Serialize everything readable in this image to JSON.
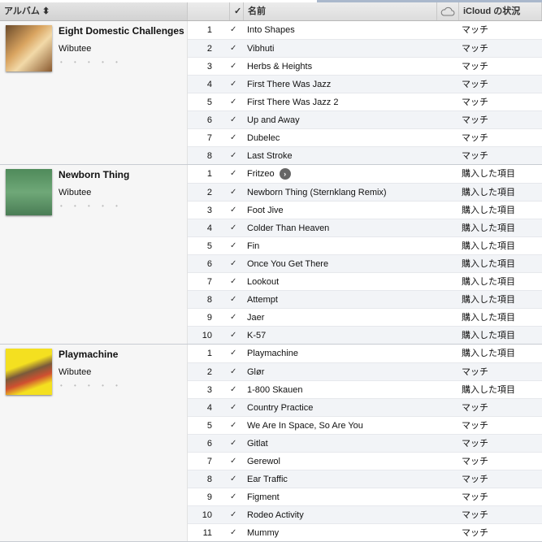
{
  "header": {
    "album": "アルバム ⬍",
    "check": "✓",
    "name": "名前",
    "status": "iCloud の状況"
  },
  "albums": [
    {
      "title": "Eight Domestic Challenges",
      "artist": "Wibutee",
      "rating": "• • • • •",
      "art": "linear-gradient(135deg,#6b4a2a,#d9a460 40%,#f2d9a8 60%,#8a5a30)",
      "tracks": [
        [
          "1",
          "Into Shapes",
          "マッチ"
        ],
        [
          "2",
          "Vibhuti",
          "マッチ"
        ],
        [
          "3",
          "Herbs & Heights",
          "マッチ"
        ],
        [
          "4",
          "First There Was Jazz",
          "マッチ"
        ],
        [
          "5",
          "First There Was Jazz 2",
          "マッチ"
        ],
        [
          "6",
          "Up and Away",
          "マッチ"
        ],
        [
          "7",
          "Dubelec",
          "マッチ"
        ],
        [
          "8",
          "Last Stroke",
          "マッチ"
        ]
      ]
    },
    {
      "title": "Newborn Thing",
      "artist": "Wibutee",
      "rating": "• • • • •",
      "art": "linear-gradient(#4f8a5a,#6fa878 50%,#4a7d55)",
      "tracks": [
        [
          "1",
          "Fritzeo",
          "購入した項目"
        ],
        [
          "2",
          "Newborn Thing (Sternklang Remix)",
          "購入した項目"
        ],
        [
          "3",
          "Foot Jive",
          "購入した項目"
        ],
        [
          "4",
          "Colder Than Heaven",
          "購入した項目"
        ],
        [
          "5",
          "Fin",
          "購入した項目"
        ],
        [
          "6",
          "Once You Get There",
          "購入した項目"
        ],
        [
          "7",
          "Lookout",
          "購入した項目"
        ],
        [
          "8",
          "Attempt",
          "購入した項目"
        ],
        [
          "9",
          "Jaer",
          "購入した項目"
        ],
        [
          "10",
          "K-57",
          "購入した項目"
        ]
      ]
    },
    {
      "title": "Playmachine",
      "artist": "Wibutee",
      "rating": "• • • • •",
      "art": "linear-gradient(160deg,#f4e020 0 35%,#7a5a3a 50%,#d05030 65%,#f4e020 80%)",
      "tracks": [
        [
          "1",
          "Playmachine",
          "購入した項目"
        ],
        [
          "2",
          "Glør",
          "マッチ"
        ],
        [
          "3",
          "1-800 Skauen",
          "購入した項目"
        ],
        [
          "4",
          "Country Practice",
          "マッチ"
        ],
        [
          "5",
          "We Are In Space, So Are You",
          "マッチ"
        ],
        [
          "6",
          "Gitlat",
          "マッチ"
        ],
        [
          "7",
          "Gerewol",
          "マッチ"
        ],
        [
          "8",
          "Ear Traffic",
          "マッチ"
        ],
        [
          "9",
          "Figment",
          "マッチ"
        ],
        [
          "10",
          "Rodeo Activity",
          "マッチ"
        ],
        [
          "11",
          "Mummy",
          "マッチ"
        ]
      ]
    }
  ],
  "check_mark": "✓",
  "arrow_glyph": "›"
}
